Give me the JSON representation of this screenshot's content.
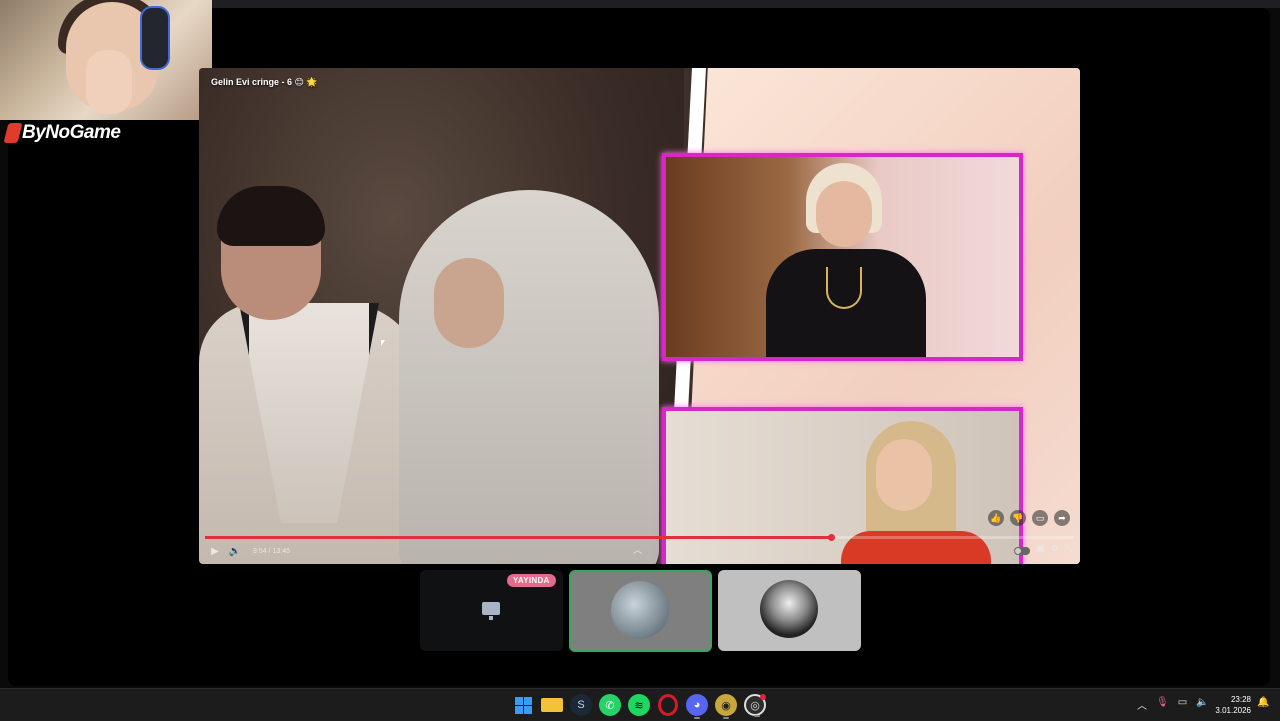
{
  "overlay": {
    "logo_text": "ByNoGame"
  },
  "video": {
    "title": "Gelin Evi cringe - 6 😊 🌟",
    "time_display": "9:54 / 13:45",
    "progress_fraction": 0.72,
    "right_actions": [
      "like-icon",
      "dislike-icon",
      "comment-icon",
      "share-icon"
    ],
    "controls_right": [
      "autoplay-toggle",
      "subtitles-icon",
      "settings-icon",
      "fullscreen-icon"
    ]
  },
  "participants": {
    "live_label": "YAYINDA"
  },
  "taskbar": {
    "apps": [
      "start",
      "file-explorer",
      "steam",
      "whatsapp",
      "spotify",
      "opera",
      "discord",
      "counter-strike",
      "obs"
    ],
    "time": "23:28",
    "date": "3.01.2026"
  },
  "colors": {
    "accent_red": "#e0303b",
    "live_badge": "#e46b8b",
    "speaking_border": "#3ba55d",
    "panel_border": "#d428c9"
  }
}
